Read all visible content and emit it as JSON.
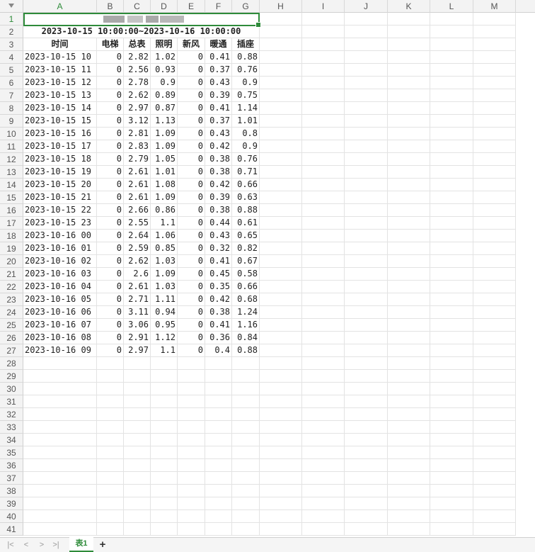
{
  "columns": [
    "A",
    "B",
    "C",
    "D",
    "E",
    "F",
    "G",
    "H",
    "I",
    "J",
    "K",
    "L",
    "M"
  ],
  "row_numbers": [
    "1",
    "2",
    "3",
    "4",
    "5",
    "6",
    "7",
    "8",
    "9",
    "10",
    "11",
    "12",
    "13",
    "14",
    "15",
    "16",
    "17",
    "18",
    "19",
    "20",
    "21",
    "22",
    "23",
    "24",
    "25",
    "26",
    "27",
    "28",
    "29",
    "30",
    "31",
    "32",
    "33",
    "34",
    "35",
    "36",
    "37",
    "38",
    "39",
    "40",
    "41"
  ],
  "sheet": {
    "title_range": "2023-10-15 10:00:00~2023-10-16 10:00:00",
    "headers": [
      "时间",
      "电梯",
      "总表",
      "照明",
      "新风",
      "暖通",
      "插座"
    ],
    "rows": [
      [
        "2023-10-15 10",
        "0",
        "2.82",
        "1.02",
        "0",
        "0.41",
        "0.88"
      ],
      [
        "2023-10-15 11",
        "0",
        "2.56",
        "0.93",
        "0",
        "0.37",
        "0.76"
      ],
      [
        "2023-10-15 12",
        "0",
        "2.78",
        "0.9",
        "0",
        "0.43",
        "0.9"
      ],
      [
        "2023-10-15 13",
        "0",
        "2.62",
        "0.89",
        "0",
        "0.39",
        "0.75"
      ],
      [
        "2023-10-15 14",
        "0",
        "2.97",
        "0.87",
        "0",
        "0.41",
        "1.14"
      ],
      [
        "2023-10-15 15",
        "0",
        "3.12",
        "1.13",
        "0",
        "0.37",
        "1.01"
      ],
      [
        "2023-10-15 16",
        "0",
        "2.81",
        "1.09",
        "0",
        "0.43",
        "0.8"
      ],
      [
        "2023-10-15 17",
        "0",
        "2.83",
        "1.09",
        "0",
        "0.42",
        "0.9"
      ],
      [
        "2023-10-15 18",
        "0",
        "2.79",
        "1.05",
        "0",
        "0.38",
        "0.76"
      ],
      [
        "2023-10-15 19",
        "0",
        "2.61",
        "1.01",
        "0",
        "0.38",
        "0.71"
      ],
      [
        "2023-10-15 20",
        "0",
        "2.61",
        "1.08",
        "0",
        "0.42",
        "0.66"
      ],
      [
        "2023-10-15 21",
        "0",
        "2.61",
        "1.09",
        "0",
        "0.39",
        "0.63"
      ],
      [
        "2023-10-15 22",
        "0",
        "2.66",
        "0.86",
        "0",
        "0.38",
        "0.88"
      ],
      [
        "2023-10-15 23",
        "0",
        "2.55",
        "1.1",
        "0",
        "0.44",
        "0.61"
      ],
      [
        "2023-10-16 00",
        "0",
        "2.64",
        "1.06",
        "0",
        "0.43",
        "0.65"
      ],
      [
        "2023-10-16 01",
        "0",
        "2.59",
        "0.85",
        "0",
        "0.32",
        "0.82"
      ],
      [
        "2023-10-16 02",
        "0",
        "2.62",
        "1.03",
        "0",
        "0.41",
        "0.67"
      ],
      [
        "2023-10-16 03",
        "0",
        "2.6",
        "1.09",
        "0",
        "0.45",
        "0.58"
      ],
      [
        "2023-10-16 04",
        "0",
        "2.61",
        "1.03",
        "0",
        "0.35",
        "0.66"
      ],
      [
        "2023-10-16 05",
        "0",
        "2.71",
        "1.11",
        "0",
        "0.42",
        "0.68"
      ],
      [
        "2023-10-16 06",
        "0",
        "3.11",
        "0.94",
        "0",
        "0.38",
        "1.24"
      ],
      [
        "2023-10-16 07",
        "0",
        "3.06",
        "0.95",
        "0",
        "0.41",
        "1.16"
      ],
      [
        "2023-10-16 08",
        "0",
        "2.91",
        "1.12",
        "0",
        "0.36",
        "0.84"
      ],
      [
        "2023-10-16 09",
        "0",
        "2.97",
        "1.1",
        "0",
        "0.4",
        "0.88"
      ]
    ]
  },
  "sheet_tabs": [
    {
      "label": "表1",
      "active": true
    }
  ],
  "icons": {
    "first": "first-sheet-icon",
    "prev": "prev-sheet-icon",
    "next": "next-sheet-icon",
    "last": "last-sheet-icon",
    "add": "add-sheet-icon"
  },
  "symbols": {
    "first": "|<",
    "prev": "<",
    "next": ">",
    "last": ">|",
    "add": "+"
  },
  "colors": {
    "accent": "#2e8b3a"
  }
}
